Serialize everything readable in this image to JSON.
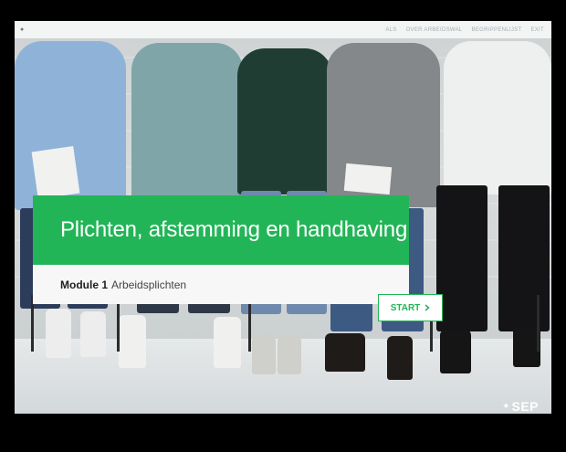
{
  "topbar": {
    "nav": [
      "ALS",
      "OVER ARBEIDSWAL",
      "BEGRIPPENLIJST",
      "EXIT"
    ]
  },
  "hero": {
    "title": "Plichten, afstemming en handhaving",
    "module_label": "Module 1",
    "module_name": "Arbeidsplichten",
    "start_label": "START",
    "start_icon": "chevron-right-icon"
  },
  "footer": {
    "logo_text": "SEP",
    "logo_mark": "✦"
  },
  "colors": {
    "accent": "#22b557",
    "background": "#000000"
  }
}
